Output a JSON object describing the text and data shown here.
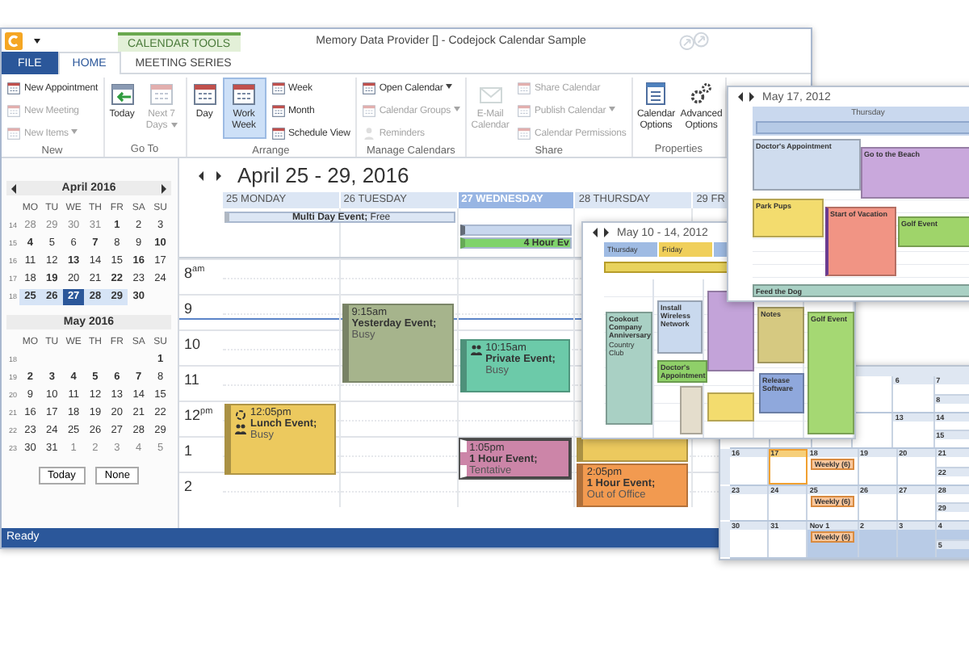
{
  "window": {
    "title": "Memory Data Provider [] - Codejock Calendar Sample",
    "context_tab": "CALENDAR TOOLS",
    "status": "Ready"
  },
  "ribbon_tabs": [
    {
      "label": "FILE",
      "kind": "file",
      "selected": false
    },
    {
      "label": "HOME",
      "kind": "tab",
      "selected": true
    },
    {
      "label": "MEETING SERIES",
      "kind": "tab",
      "selected": false
    }
  ],
  "ribbon_groups": [
    {
      "label": "New",
      "items": [
        {
          "label": "New Appointment",
          "kind": "small",
          "disabled": false,
          "selected": false,
          "dropdown": false
        },
        {
          "label": "New Meeting",
          "kind": "small",
          "disabled": true,
          "selected": false,
          "dropdown": false
        },
        {
          "label": "New Items",
          "kind": "small",
          "disabled": true,
          "selected": false,
          "dropdown": true
        }
      ]
    },
    {
      "label": "Go To",
      "items": [
        {
          "label": "Today",
          "kind": "large",
          "disabled": false,
          "selected": false,
          "dropdown": false
        },
        {
          "label": "Next 7 Days",
          "kind": "large",
          "disabled": true,
          "selected": false,
          "dropdown": true
        }
      ]
    },
    {
      "label": "Arrange",
      "items": [
        {
          "label": "Day",
          "kind": "large",
          "disabled": false,
          "selected": false,
          "dropdown": false
        },
        {
          "label": "Work Week",
          "kind": "large",
          "disabled": false,
          "selected": true,
          "dropdown": false
        },
        {
          "label": "Week",
          "kind": "small",
          "disabled": false,
          "selected": false,
          "dropdown": false
        },
        {
          "label": "Month",
          "kind": "small",
          "disabled": false,
          "selected": false,
          "dropdown": false
        },
        {
          "label": "Schedule View",
          "kind": "small",
          "disabled": false,
          "selected": false,
          "dropdown": false
        }
      ]
    },
    {
      "label": "Manage Calendars",
      "items": [
        {
          "label": "Open Calendar",
          "kind": "small",
          "disabled": false,
          "selected": false,
          "dropdown": true
        },
        {
          "label": "Calendar Groups",
          "kind": "small",
          "disabled": true,
          "selected": false,
          "dropdown": true
        },
        {
          "label": "Reminders",
          "kind": "small",
          "disabled": true,
          "selected": false,
          "dropdown": false
        }
      ]
    },
    {
      "label": "Share",
      "items": [
        {
          "label": "E-Mail Calendar",
          "kind": "large",
          "disabled": true,
          "selected": false,
          "dropdown": false
        },
        {
          "label": "Share Calendar",
          "kind": "small",
          "disabled": true,
          "selected": false,
          "dropdown": false
        },
        {
          "label": "Publish Calendar",
          "kind": "small",
          "disabled": true,
          "selected": false,
          "dropdown": true
        },
        {
          "label": "Calendar Permissions",
          "kind": "small",
          "disabled": true,
          "selected": false,
          "dropdown": false
        }
      ]
    },
    {
      "label": "Properties",
      "items": [
        {
          "label": "Calendar Options",
          "kind": "large",
          "disabled": false,
          "selected": false,
          "dropdown": false
        },
        {
          "label": "Advanced Options",
          "kind": "large",
          "disabled": false,
          "selected": false,
          "dropdown": false
        }
      ]
    }
  ],
  "mini_months": [
    {
      "title": "April 2016",
      "arrows": true,
      "weekdays": [
        "MO",
        "TU",
        "WE",
        "TH",
        "FR",
        "SA",
        "SU"
      ],
      "weeks": [
        {
          "number": "14",
          "days": [
            {
              "t": "28",
              "kind": "other",
              "selected": false
            },
            {
              "t": "29",
              "kind": "other",
              "selected": false
            },
            {
              "t": "30",
              "kind": "other",
              "selected": false
            },
            {
              "t": "31",
              "kind": "other",
              "selected": false
            },
            {
              "t": "1",
              "kind": "busy",
              "selected": false
            },
            {
              "t": "2",
              "kind": "plain",
              "selected": false
            },
            {
              "t": "3",
              "kind": "plain",
              "selected": false
            }
          ]
        },
        {
          "number": "15",
          "days": [
            {
              "t": "4",
              "kind": "busy",
              "selected": false
            },
            {
              "t": "5",
              "kind": "plain",
              "selected": false
            },
            {
              "t": "6",
              "kind": "plain",
              "selected": false
            },
            {
              "t": "7",
              "kind": "busy",
              "selected": false
            },
            {
              "t": "8",
              "kind": "plain",
              "selected": false
            },
            {
              "t": "9",
              "kind": "plain",
              "selected": false
            },
            {
              "t": "10",
              "kind": "busy",
              "selected": false
            }
          ]
        },
        {
          "number": "16",
          "days": [
            {
              "t": "11",
              "kind": "plain",
              "selected": false
            },
            {
              "t": "12",
              "kind": "plain",
              "selected": false
            },
            {
              "t": "13",
              "kind": "busy",
              "selected": false
            },
            {
              "t": "14",
              "kind": "plain",
              "selected": false
            },
            {
              "t": "15",
              "kind": "plain",
              "selected": false
            },
            {
              "t": "16",
              "kind": "busy",
              "selected": false
            },
            {
              "t": "17",
              "kind": "plain",
              "selected": false
            }
          ]
        },
        {
          "number": "17",
          "days": [
            {
              "t": "18",
              "kind": "plain",
              "selected": false
            },
            {
              "t": "19",
              "kind": "busy",
              "selected": false
            },
            {
              "t": "20",
              "kind": "plain",
              "selected": false
            },
            {
              "t": "21",
              "kind": "plain",
              "selected": false
            },
            {
              "t": "22",
              "kind": "busy",
              "selected": false
            },
            {
              "t": "23",
              "kind": "plain",
              "selected": false
            },
            {
              "t": "24",
              "kind": "plain",
              "selected": false
            }
          ]
        },
        {
          "number": "18",
          "days": [
            {
              "t": "25",
              "kind": "busy",
              "selected": true
            },
            {
              "t": "26",
              "kind": "busy",
              "selected": true
            },
            {
              "t": "27",
              "kind": "today",
              "selected": true
            },
            {
              "t": "28",
              "kind": "busy",
              "selected": true
            },
            {
              "t": "29",
              "kind": "busy",
              "selected": true
            },
            {
              "t": "30",
              "kind": "busy",
              "selected": false
            },
            {
              "kind": "blank"
            }
          ]
        }
      ]
    },
    {
      "title": "May 2016",
      "arrows": false,
      "weekdays": [
        "MO",
        "TU",
        "WE",
        "TH",
        "FR",
        "SA",
        "SU"
      ],
      "weeks": [
        {
          "number": "18",
          "days": [
            {
              "kind": "blank"
            },
            {
              "kind": "blank"
            },
            {
              "kind": "blank"
            },
            {
              "kind": "blank"
            },
            {
              "kind": "blank"
            },
            {
              "kind": "blank"
            },
            {
              "t": "1",
              "kind": "busy",
              "selected": false
            }
          ]
        },
        {
          "number": "19",
          "days": [
            {
              "t": "2",
              "kind": "busy",
              "selected": false
            },
            {
              "t": "3",
              "kind": "busy",
              "selected": false
            },
            {
              "t": "4",
              "kind": "busy",
              "selected": false
            },
            {
              "t": "5",
              "kind": "busy",
              "selected": false
            },
            {
              "t": "6",
              "kind": "busy",
              "selected": false
            },
            {
              "t": "7",
              "kind": "busy",
              "selected": false
            },
            {
              "t": "8",
              "kind": "plain",
              "selected": false
            }
          ]
        },
        {
          "number": "20",
          "days": [
            {
              "t": "9",
              "kind": "plain",
              "selected": false
            },
            {
              "t": "10",
              "kind": "plain",
              "selected": false
            },
            {
              "t": "11",
              "kind": "plain",
              "selected": false
            },
            {
              "t": "12",
              "kind": "plain",
              "selected": false
            },
            {
              "t": "13",
              "kind": "plain",
              "selected": false
            },
            {
              "t": "14",
              "kind": "plain",
              "selected": false
            },
            {
              "t": "15",
              "kind": "plain",
              "selected": false
            }
          ]
        },
        {
          "number": "21",
          "days": [
            {
              "t": "16",
              "kind": "plain",
              "selected": false
            },
            {
              "t": "17",
              "kind": "plain",
              "selected": false
            },
            {
              "t": "18",
              "kind": "plain",
              "selected": false
            },
            {
              "t": "19",
              "kind": "plain",
              "selected": false
            },
            {
              "t": "20",
              "kind": "plain",
              "selected": false
            },
            {
              "t": "21",
              "kind": "plain",
              "selected": false
            },
            {
              "t": "22",
              "kind": "plain",
              "selected": false
            }
          ]
        },
        {
          "number": "22",
          "days": [
            {
              "t": "23",
              "kind": "plain",
              "selected": false
            },
            {
              "t": "24",
              "kind": "plain",
              "selected": false
            },
            {
              "t": "25",
              "kind": "plain",
              "selected": false
            },
            {
              "t": "26",
              "kind": "plain",
              "selected": false
            },
            {
              "t": "27",
              "kind": "plain",
              "selected": false
            },
            {
              "t": "28",
              "kind": "plain",
              "selected": false
            },
            {
              "t": "29",
              "kind": "plain",
              "selected": false
            }
          ]
        },
        {
          "number": "23",
          "days": [
            {
              "t": "30",
              "kind": "plain",
              "selected": false
            },
            {
              "t": "31",
              "kind": "plain",
              "selected": false
            },
            {
              "t": "1",
              "kind": "other",
              "selected": false
            },
            {
              "t": "2",
              "kind": "other",
              "selected": false
            },
            {
              "t": "3",
              "kind": "other",
              "selected": false
            },
            {
              "t": "4",
              "kind": "other",
              "selected": false
            },
            {
              "t": "5",
              "kind": "other",
              "selected": false
            }
          ]
        }
      ]
    }
  ],
  "mini_buttons": [
    "Today",
    "None"
  ],
  "calendar": {
    "title": "April 25 - 29, 2016",
    "days": [
      {
        "label": "25 MONDAY",
        "selected": false
      },
      {
        "label": "26 TUESDAY",
        "selected": false
      },
      {
        "label": "27 WEDNESDAY",
        "selected": true
      },
      {
        "label": "28 THURSDAY",
        "selected": false
      },
      {
        "label": "29 FR",
        "selected": false
      }
    ],
    "all_day": [
      {
        "kind": "normal",
        "title": "Multi Day Event;",
        "status": "Free",
        "color": "#dce6f4"
      },
      {
        "kind": "blank",
        "color": "#c8d7ee"
      },
      {
        "kind": "clipped",
        "title": "4 Hour Ev",
        "color": "#7fd36b"
      }
    ],
    "hours": [
      "8$^{am}$",
      "9",
      "10",
      "11",
      "12$^{pm}$",
      "1",
      "2"
    ],
    "events": [
      {
        "kind": "normal",
        "time": "9:15am",
        "title": "Yesterday Event;",
        "status": "Busy",
        "color": "#a6b48c"
      },
      {
        "kind": "normal",
        "time": "10:15am",
        "title": "Private Event;",
        "status": "Busy",
        "color": "#6ccaa9"
      },
      {
        "kind": "normal",
        "time": "12:05pm",
        "title": "Lunch Event;",
        "status": "Busy",
        "color": "#ecc95e"
      },
      {
        "kind": "tentative",
        "time": "1:05pm",
        "title": "1 Hour Event;",
        "status": "Tentative",
        "color": "#cc85a8"
      },
      {
        "kind": "normal",
        "color": "#ecc95e"
      },
      {
        "kind": "normal",
        "time": "2:05pm",
        "title": "1 Hour Event;",
        "status": "Out of Office",
        "color": "#f29a50"
      }
    ]
  },
  "day_window": {
    "title": "May 17, 2012",
    "day": "Thursday",
    "events": [
      {
        "title": "Doctor's Appointment",
        "color": "#cfdcee"
      },
      {
        "title": "Go to the Beach",
        "color": "#c9a8dc"
      },
      {
        "title": "Park Pups",
        "color": "#f3dc6e"
      },
      {
        "title": "Start of Vacation",
        "color": "#f19484"
      },
      {
        "title": "Golf Event",
        "color": "#9fd46a"
      },
      {
        "title": "Feed the Dog",
        "color": "#a9d0c4"
      }
    ]
  },
  "week_window": {
    "title": "May 10 - 14, 2012",
    "days": [
      "Thursday",
      "Friday"
    ],
    "events": [
      {
        "title": "Cookout Company Anniversary",
        "note": "Country Club",
        "color": "#a9d0c4"
      },
      {
        "title": "Install Wireless Network",
        "color": "#c9d9ee"
      },
      {
        "title": "Doctor's Appointment",
        "color": "#8fd069"
      },
      {
        "color": "#e4ddcc"
      },
      {
        "color": "#c3a3d9"
      },
      {
        "color": "#f3dc6e"
      },
      {
        "title": "Notes",
        "color": "#d6c981"
      },
      {
        "title": "Release Software",
        "color": "#8fa8dc"
      },
      {
        "title": "Golf Event",
        "color": "#a5d873"
      }
    ]
  },
  "month_window": {
    "weeks": [
      {
        "days": [
          {
            "kind": "blank"
          },
          {
            "kind": "blank"
          },
          {
            "kind": "blank"
          },
          {
            "kind": "blank"
          },
          {
            "t": "6",
            "kind": "plain"
          },
          {
            "t": "7",
            "kind": "plain"
          },
          {
            "t": "8",
            "kind": "plain"
          }
        ]
      },
      {
        "days": [
          {
            "kind": "blank"
          },
          {
            "kind": "blank"
          },
          {
            "kind": "blank"
          },
          {
            "kind": "blank"
          },
          {
            "t": "13",
            "kind": "plain"
          },
          {
            "t": "14",
            "kind": "plain"
          },
          {
            "t": "15",
            "kind": "plain"
          }
        ]
      },
      {
        "days": [
          {
            "t": "16",
            "kind": "plain"
          },
          {
            "t": "17",
            "kind": "today"
          },
          {
            "t": "18",
            "kind": "plain",
            "events": [
              "Weekly (6)"
            ]
          },
          {
            "t": "19",
            "kind": "plain"
          },
          {
            "t": "20",
            "kind": "plain"
          },
          {
            "t": "21",
            "kind": "plain"
          },
          {
            "t": "22",
            "kind": "plain"
          }
        ]
      },
      {
        "days": [
          {
            "t": "23",
            "kind": "plain"
          },
          {
            "t": "24",
            "kind": "plain"
          },
          {
            "t": "25",
            "kind": "plain",
            "events": [
              "Weekly (6)"
            ]
          },
          {
            "t": "26",
            "kind": "plain"
          },
          {
            "t": "27",
            "kind": "plain"
          },
          {
            "t": "28",
            "kind": "plain"
          },
          {
            "t": "29",
            "kind": "plain"
          }
        ]
      },
      {
        "days": [
          {
            "t": "30",
            "kind": "plain"
          },
          {
            "t": "31",
            "kind": "plain"
          },
          {
            "t": "Nov 1",
            "kind": "other",
            "events": [
              "Weekly (6)"
            ]
          },
          {
            "t": "2",
            "kind": "other"
          },
          {
            "t": "3",
            "kind": "other"
          },
          {
            "t": "4",
            "kind": "other"
          },
          {
            "t": "5",
            "kind": "other"
          }
        ]
      }
    ]
  }
}
